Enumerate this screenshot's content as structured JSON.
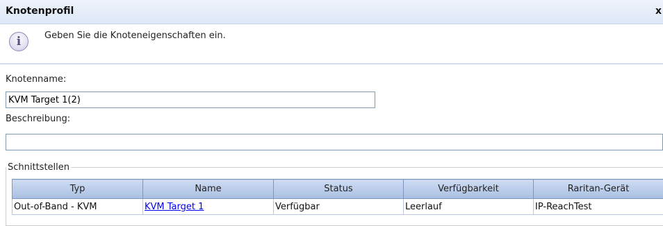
{
  "dialog": {
    "title": "Knotenprofil",
    "close_label": "x"
  },
  "info": {
    "icon": "info-icon",
    "message": "Geben Sie die Knoteneigenschaften ein."
  },
  "form": {
    "node_name_label": "Knotenname:",
    "node_name_value": "KVM Target 1(2)",
    "description_label": "Beschreibung:",
    "description_value": ""
  },
  "interfaces": {
    "legend": "Schnittstellen",
    "columns": [
      "Typ",
      "Name",
      "Status",
      "Verfügbarkeit",
      "Raritan-Gerät"
    ],
    "rows": [
      {
        "type": "Out-of-Band - KVM",
        "name": "KVM Target 1",
        "status": "Verfügbar",
        "availability": "Leerlauf",
        "device": "IP-ReachTest"
      }
    ]
  }
}
